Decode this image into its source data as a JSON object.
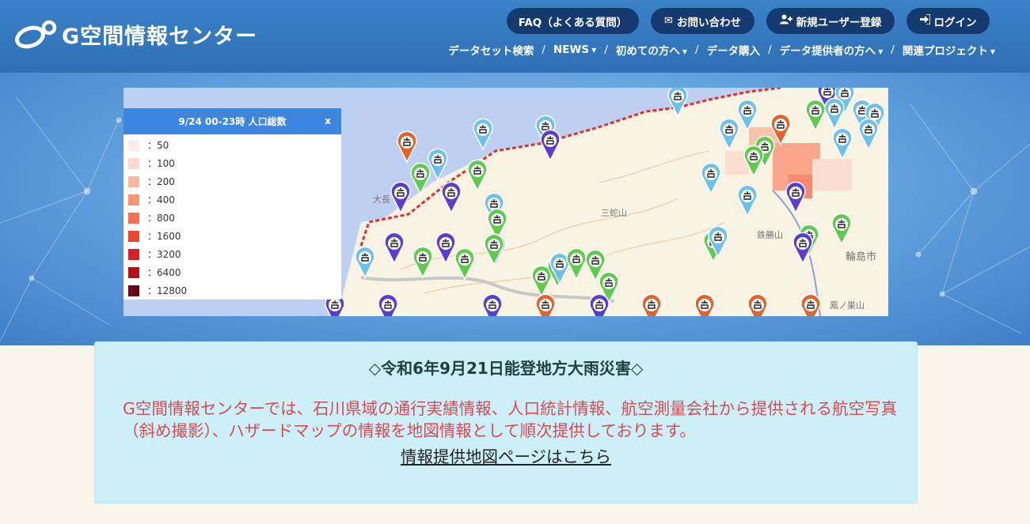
{
  "header": {
    "logo_text": "G空間情報センター",
    "buttons": {
      "faq": "FAQ（よくある質問）",
      "contact": "お問い合わせ",
      "register": "新規ユーザー登録",
      "login": "ログイン"
    },
    "nav": [
      {
        "label": "データセット検索",
        "dropdown": false
      },
      {
        "label": "NEWS",
        "dropdown": true
      },
      {
        "label": "初めての方へ",
        "dropdown": true
      },
      {
        "label": "データ購入",
        "dropdown": false
      },
      {
        "label": "データ提供者の方へ",
        "dropdown": true
      },
      {
        "label": "関連プロジェクト",
        "dropdown": true
      }
    ]
  },
  "map": {
    "legend": {
      "title": "9/24 00-23時 人口総数",
      "close": "x",
      "rows": [
        {
          "label": "：50",
          "color": "#fcebe6"
        },
        {
          "label": "：100",
          "color": "#fcd9cc"
        },
        {
          "label": "：200",
          "color": "#fbb89e"
        },
        {
          "label": "：400",
          "color": "#f99474"
        },
        {
          "label": "：800",
          "color": "#f57052"
        },
        {
          "label": "：1600",
          "color": "#ee4435"
        },
        {
          "label": "：3200",
          "color": "#d42323"
        },
        {
          "label": "：6400",
          "color": "#b01217"
        },
        {
          "label": "：12800",
          "color": "#6b0513"
        }
      ]
    },
    "place_labels": [
      "三蛇山",
      "鉄勝山",
      "輪島市",
      "鳳ノ巣山",
      "大長"
    ],
    "marker_colors": {
      "purple": "#5a3fcf",
      "green": "#5ecb4f",
      "lightblue": "#6ec1ec",
      "orange": "#e0642c"
    }
  },
  "notice": {
    "title": "◇令和6年9月21日能登地方大雨災害◇",
    "body": "G空間情報センターでは、石川県域の通行実績情報、人口統計情報、航空測量会社から提供される航空写真（斜め撮影）、ハザードマップの情報を地図情報として順次提供しております。",
    "link": "情報提供地図ページはこちら"
  }
}
